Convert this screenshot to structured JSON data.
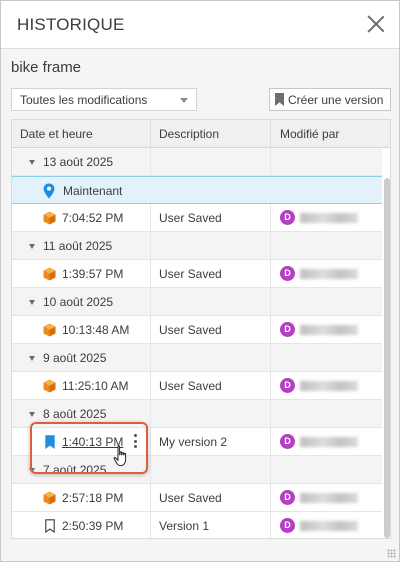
{
  "panel": {
    "title": "HISTORIQUE",
    "document_name": "bike frame"
  },
  "toolbar": {
    "filter_value": "Toutes les modifications",
    "create_version_label": "Créer une version"
  },
  "table": {
    "columns": [
      "Date et heure",
      "Description",
      "Modifié par"
    ],
    "rows": {
      "g1": {
        "label": "13 août 2025"
      },
      "now": {
        "label": "Maintenant"
      },
      "r1": {
        "time": "7:04:52 PM",
        "description": "User Saved",
        "avatar": "D"
      },
      "g2": {
        "label": "11 août 2025"
      },
      "r2": {
        "time": "1:39:57 PM",
        "description": "User Saved",
        "avatar": "D"
      },
      "g3": {
        "label": "10 août 2025"
      },
      "r3": {
        "time": "10:13:48 AM",
        "description": "User Saved",
        "avatar": "D"
      },
      "g4": {
        "label": "9 août 2025"
      },
      "r4": {
        "time": "11:25:10 AM",
        "description": "User Saved",
        "avatar": "D"
      },
      "g5": {
        "label": "8 août 2025"
      },
      "r5": {
        "time": "1:40:13 PM",
        "description": "My version 2",
        "avatar": "D"
      },
      "g6": {
        "label": "7 août 2025"
      },
      "r6": {
        "time": "2:57:18 PM",
        "description": "User Saved",
        "avatar": "D"
      },
      "r7": {
        "time": "2:50:39 PM",
        "description": "Version 1",
        "avatar": "D"
      }
    }
  },
  "colors": {
    "accent": "#1e8ede",
    "avatar": "#b53fc4",
    "highlight_border": "#d9603a",
    "cube_orange": "#f08c1e"
  },
  "icons": {
    "close": "close-icon",
    "dropdown": "chevron-down-icon",
    "bookmark": "bookmark-icon",
    "current": "location-pin-icon",
    "saved": "cube-icon",
    "kebab": "more-vertical-icon",
    "cursor": "hand-pointer-icon"
  }
}
